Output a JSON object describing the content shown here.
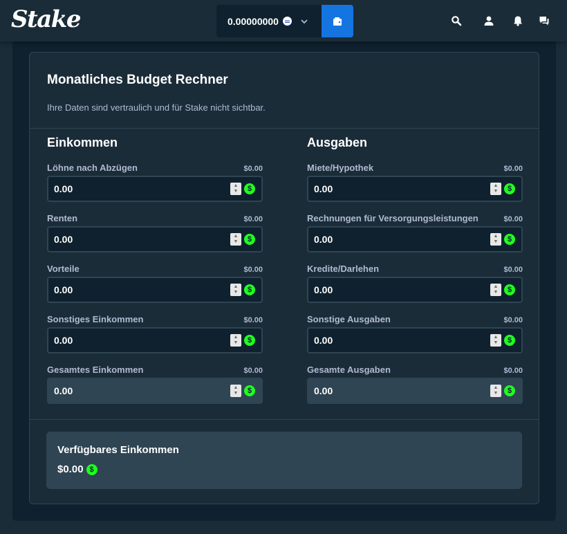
{
  "header": {
    "logo": "Stake",
    "wallet_amount": "0.00000000",
    "wallet_currency_icon": "ethereum-icon",
    "icons": [
      "search-icon",
      "user-icon",
      "bell-icon",
      "chat-icon"
    ]
  },
  "calculator": {
    "title": "Monatliches Budget Rechner",
    "subtitle": "Ihre Daten sind vertraulich und für Stake nicht sichtbar.",
    "income": {
      "title": "Einkommen",
      "fields": [
        {
          "label": "Löhne nach Abzügen",
          "summary": "$0.00",
          "value": "0.00"
        },
        {
          "label": "Renten",
          "summary": "$0.00",
          "value": "0.00"
        },
        {
          "label": "Vorteile",
          "summary": "$0.00",
          "value": "0.00"
        },
        {
          "label": "Sonstiges Einkommen",
          "summary": "$0.00",
          "value": "0.00"
        },
        {
          "label": "Gesamtes Einkommen",
          "summary": "$0.00",
          "value": "0.00"
        }
      ]
    },
    "expenses": {
      "title": "Ausgaben",
      "fields": [
        {
          "label": "Miete/Hypothek",
          "summary": "$0.00",
          "value": "0.00"
        },
        {
          "label": "Rechnungen für Versorgungsleistungen",
          "summary": "$0.00",
          "value": "0.00"
        },
        {
          "label": "Kredite/Darlehen",
          "summary": "$0.00",
          "value": "0.00"
        },
        {
          "label": "Sonstige Ausgaben",
          "summary": "$0.00",
          "value": "0.00"
        },
        {
          "label": "Gesamte Ausgaben",
          "summary": "$0.00",
          "value": "0.00"
        }
      ]
    },
    "available": {
      "title": "Verfügbares Einkommen",
      "amount": "$0.00"
    }
  },
  "colors": {
    "background": "#1a2c38",
    "panel": "#0f212e",
    "border": "#2f4553",
    "accent_blue": "#1475e1",
    "currency_green": "#1fff20",
    "muted_text": "#b1bad3"
  }
}
